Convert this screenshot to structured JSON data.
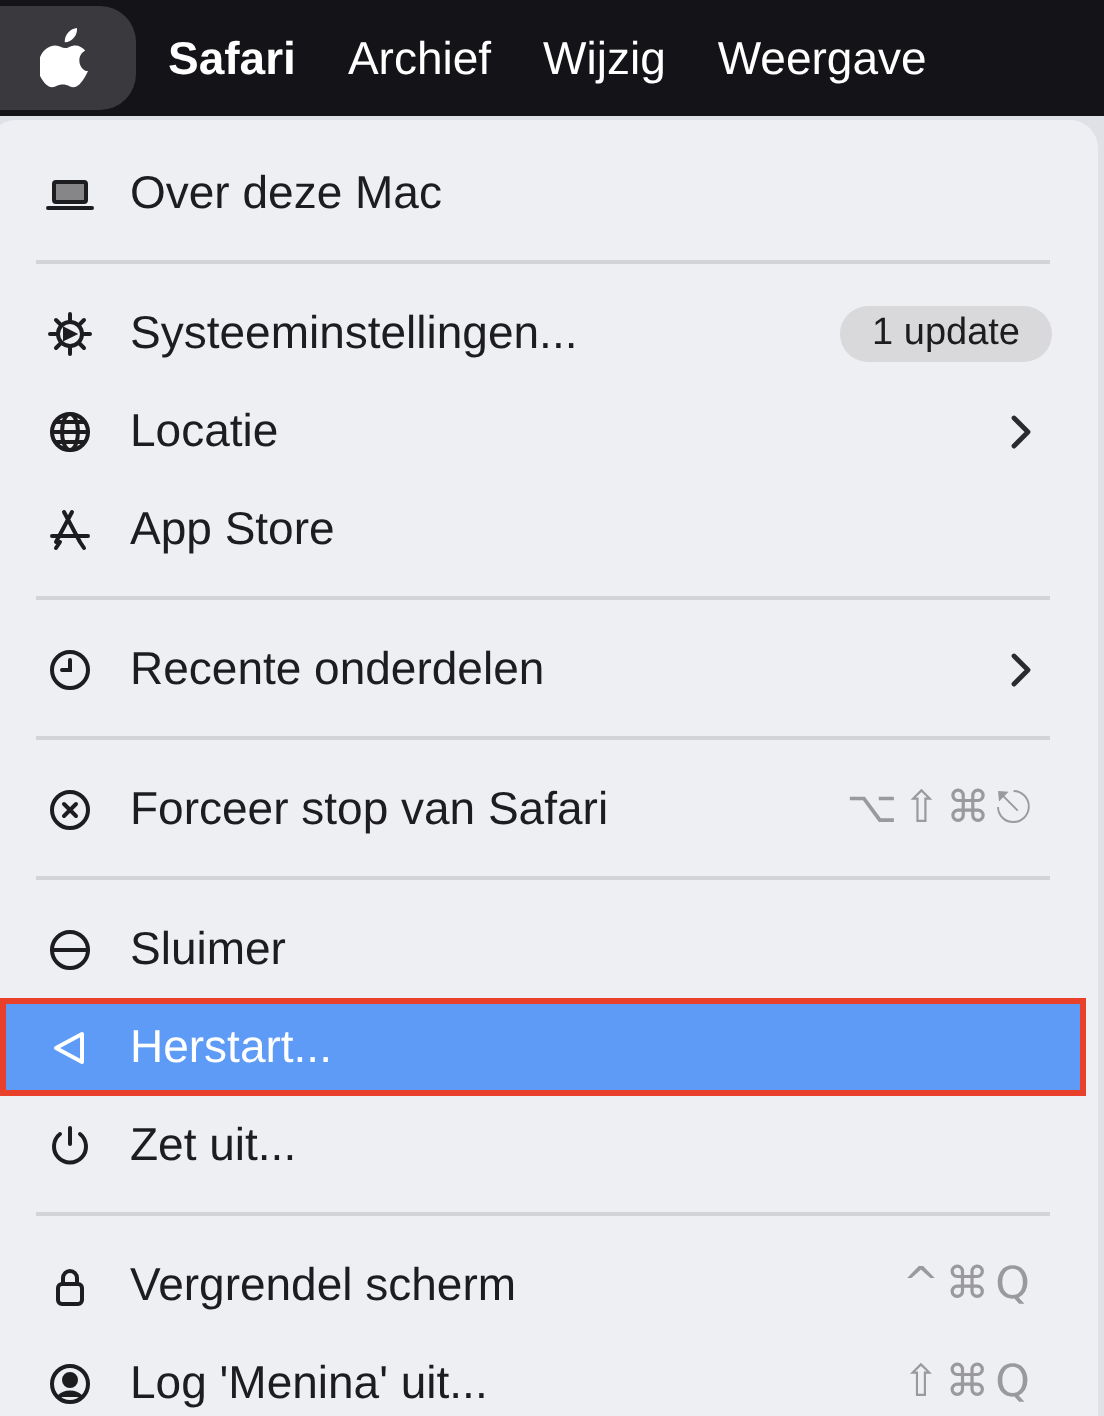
{
  "menu_bar": {
    "apple_menu": {
      "selected": true
    },
    "items": [
      {
        "label": "Safari",
        "kind": "app"
      },
      {
        "label": "Archief",
        "kind": "menu"
      },
      {
        "label": "Wijzig",
        "kind": "menu"
      },
      {
        "label": "Weergave",
        "kind": "menu"
      }
    ]
  },
  "apple_menu": {
    "sections": [
      {
        "items": [
          {
            "label": "Over deze Mac",
            "selected": false,
            "submenu": false
          }
        ]
      },
      {
        "items": [
          {
            "label": "Systeeminstellingen...",
            "selected": false,
            "submenu": false,
            "badge": "1 update"
          },
          {
            "label": "Locatie",
            "selected": false,
            "submenu": true
          },
          {
            "label": "App Store",
            "selected": false,
            "submenu": false
          }
        ]
      },
      {
        "items": [
          {
            "label": "Recente onderdelen",
            "selected": false,
            "submenu": true
          }
        ]
      },
      {
        "items": [
          {
            "label": "Forceer stop van Safari",
            "selected": false,
            "submenu": false,
            "shortcut": "⌥⇧⌘⎋"
          }
        ]
      },
      {
        "items": [
          {
            "label": "Sluimer",
            "selected": false,
            "submenu": false
          },
          {
            "label": "Herstart...",
            "selected": true,
            "submenu": false
          },
          {
            "label": "Zet uit...",
            "selected": false,
            "submenu": false
          }
        ]
      },
      {
        "items": [
          {
            "label": "Vergrendel scherm",
            "selected": false,
            "submenu": false,
            "shortcut": "^⌘Q"
          },
          {
            "label": "Log 'Menina' uit...",
            "selected": false,
            "submenu": false,
            "shortcut": "⇧⌘Q"
          }
        ]
      }
    ]
  }
}
